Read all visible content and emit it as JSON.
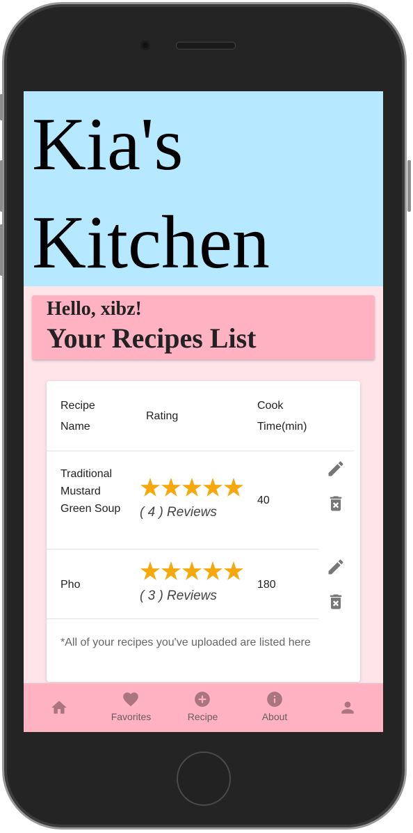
{
  "app": {
    "title": "Kia's Kitchen"
  },
  "greeting": "Hello, xibz!",
  "list_title": "Your Recipes List",
  "table": {
    "headers": [
      "Recipe Name",
      "Rating",
      "Cook Time(min)"
    ],
    "rows": [
      {
        "name": "Traditional Mustard Green Soup",
        "stars": 5,
        "reviews": "( 4 ) Reviews",
        "cook_time": "40"
      },
      {
        "name": "Pho",
        "stars": 5,
        "reviews": "( 3 ) Reviews",
        "cook_time": "180"
      }
    ],
    "note": "*All of your recipes you've uploaded are listed here"
  },
  "nav": [
    {
      "label": "",
      "icon": "home-icon"
    },
    {
      "label": "Favorites",
      "icon": "heart-icon"
    },
    {
      "label": "Recipe",
      "icon": "add-circle-icon"
    },
    {
      "label": "About",
      "icon": "info-icon"
    },
    {
      "label": "",
      "icon": "person-icon"
    }
  ],
  "colors": {
    "header_bg": "#b6e9ff",
    "page_bg": "#ffe4ea",
    "accent_pink": "#ffb3c2",
    "star": "#f5a90f",
    "icon_gray": "#777777"
  }
}
